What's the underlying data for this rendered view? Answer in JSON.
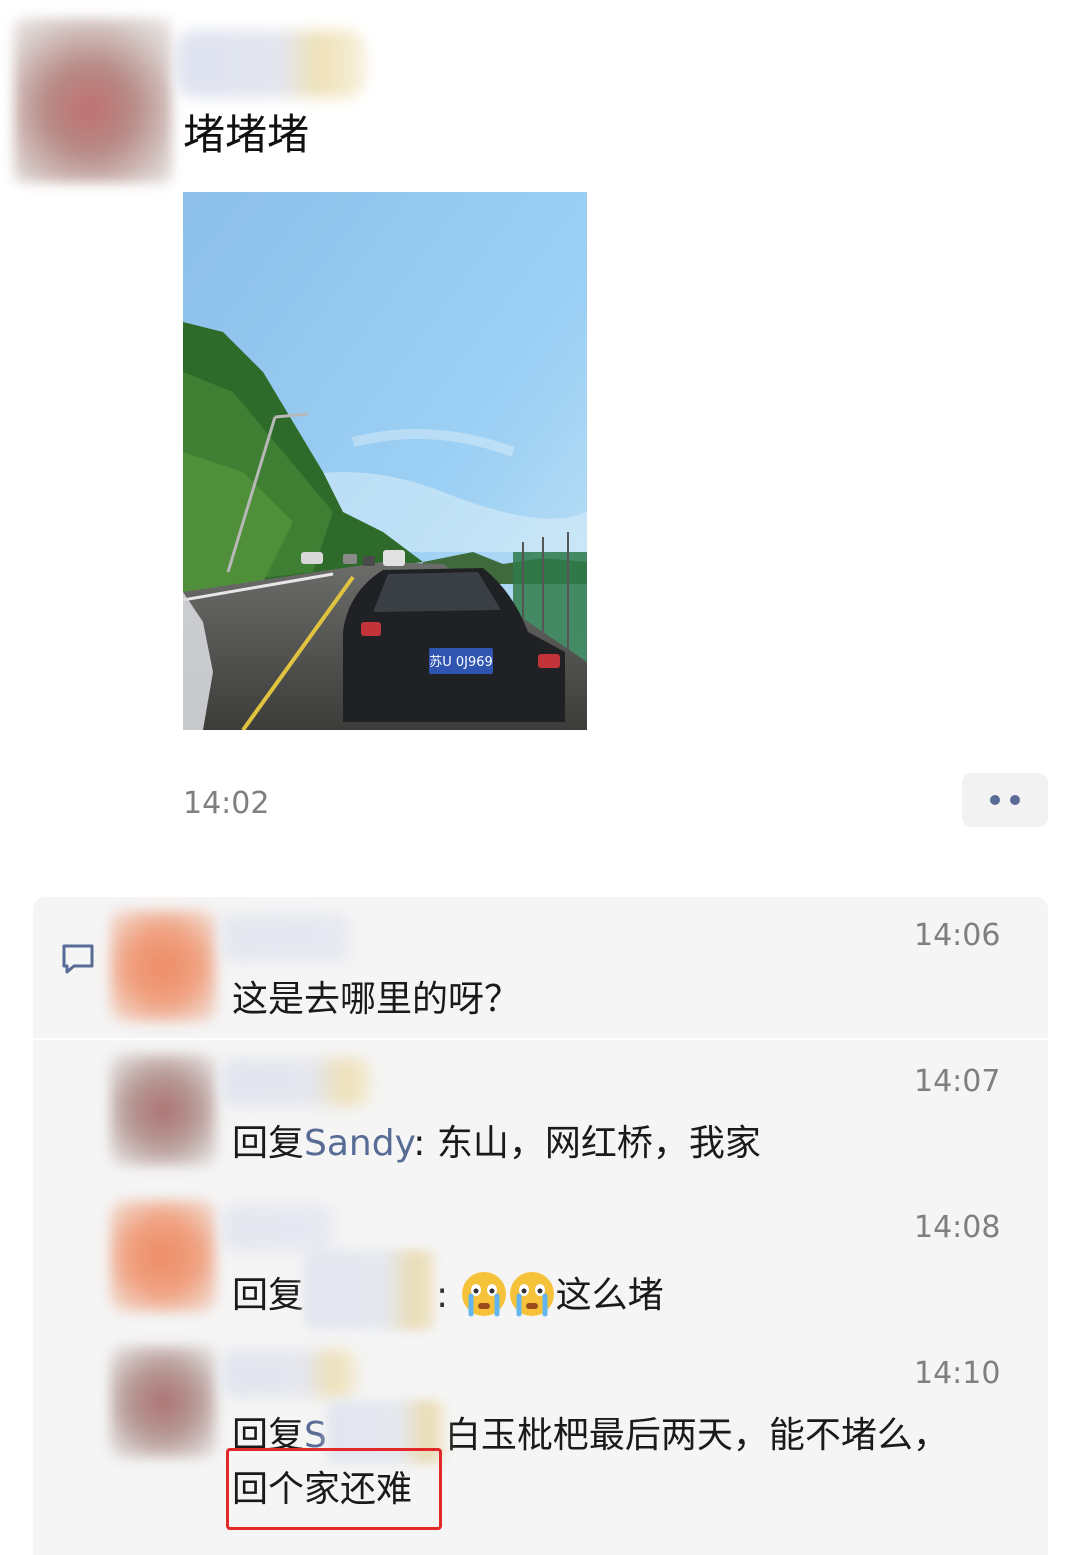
{
  "post": {
    "text": "堵堵堵",
    "time": "14:02"
  },
  "comments": [
    {
      "time": "14:06",
      "text": "这是去哪里的呀？"
    },
    {
      "time": "14:07",
      "reply_prefix": "回复",
      "reply_to": "Sandy",
      "separator": ": ",
      "text": "东山，网红桥，我家"
    },
    {
      "time": "14:08",
      "reply_prefix": "回复",
      "separator": ": ",
      "emoji": [
        "crying-face",
        "crying-face"
      ],
      "text": "这么堵"
    },
    {
      "time": "14:10",
      "reply_prefix": "回复",
      "reply_to_partial": "S",
      "text_line1": "白玉枇杷最后两天，能不堵么，",
      "text_line2": "回个家还难"
    }
  ],
  "photo": {
    "plate": "苏U 0J969"
  },
  "colors": {
    "link": "#576b95",
    "panel": "#f5f5f5",
    "highlight": "#e22828"
  }
}
